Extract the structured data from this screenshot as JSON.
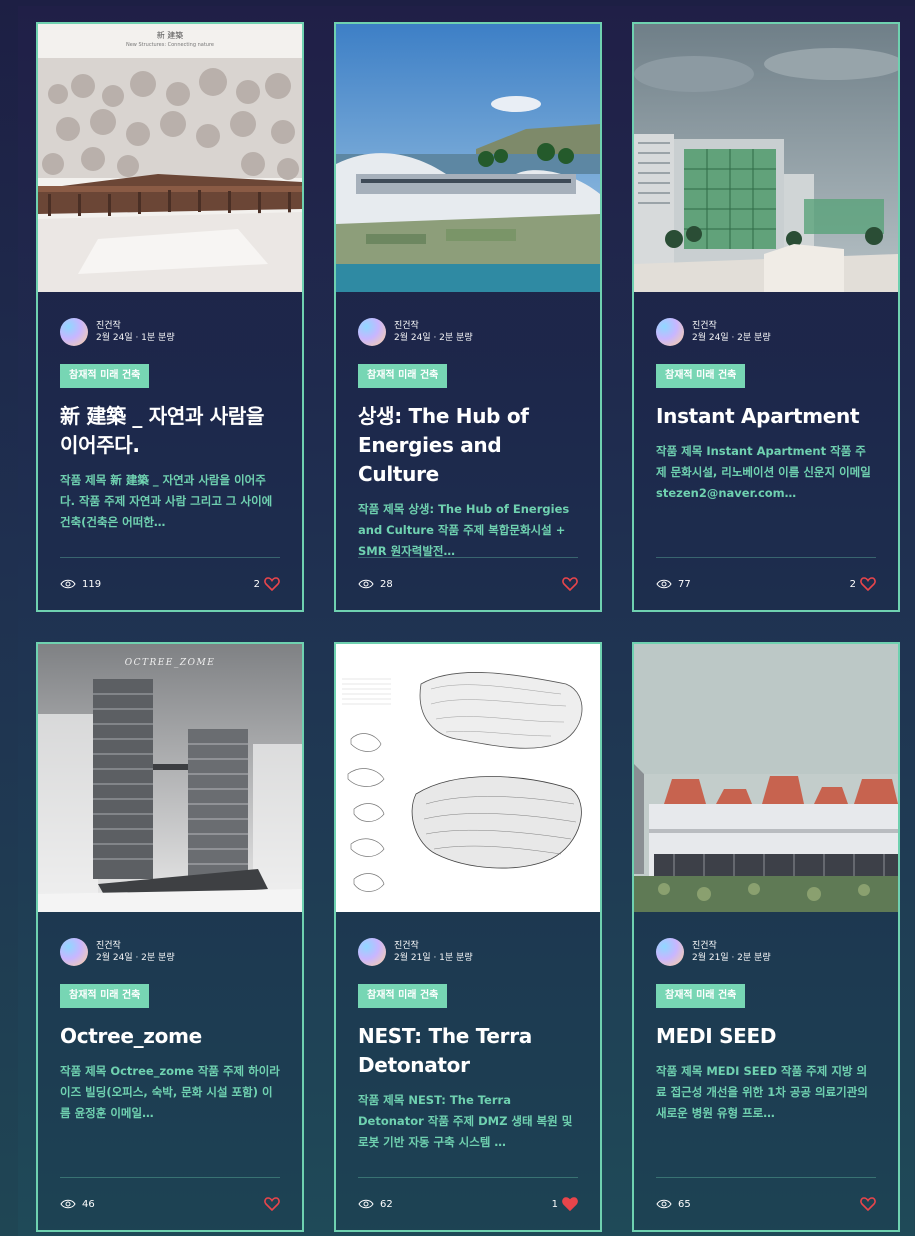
{
  "cards": [
    {
      "author": "진건작",
      "meta": "2월 24일 · 1분 분량",
      "tag": "참재적 미래 건축",
      "title": "新 建築 _ 자연과 사람을 이어주다.",
      "excerpt": "작품 제목 新 建築 _ 자연과 사람을 이어주다. 작품 주제 자연과 사람 그리고 그 사이에 건축(건축은 어떠한…",
      "views": "119",
      "likes": "2",
      "liked": false,
      "image_label": "新 建築",
      "image_sublabel": "New Structures: Connecting nature"
    },
    {
      "author": "진건작",
      "meta": "2월 24일 · 2분 분량",
      "tag": "참재적 미래 건축",
      "title": "상생: The Hub of Energies and Culture",
      "excerpt": "작품 제목 상생: The Hub of Energies and Culture 작품 주제 복합문화시설 + SMR 원자력발전…",
      "views": "28",
      "likes": "",
      "liked": false
    },
    {
      "author": "진건작",
      "meta": "2월 24일 · 2분 분량",
      "tag": "참재적 미래 건축",
      "title": "Instant Apartment",
      "excerpt": "작품 제목 Instant Apartment 작품 주제 문화시설, 리노베이션 이름 신운지 이메일 stezen2@naver.com…",
      "views": "77",
      "likes": "2",
      "liked": false
    },
    {
      "author": "진건작",
      "meta": "2월 24일 · 2분 분량",
      "tag": "참재적 미래 건축",
      "title": "Octree_zome",
      "excerpt": "작품 제목 Octree_zome 작품 주제 하이라이즈 빌딩(오피스, 숙박, 문화 시설 포함) 이름 윤정훈 이메일…",
      "views": "46",
      "likes": "",
      "liked": false,
      "image_label": "OCTREE_ZOME"
    },
    {
      "author": "진건작",
      "meta": "2월 21일 · 1분 분량",
      "tag": "참재적 미래 건축",
      "title": "NEST: The Terra Detonator",
      "excerpt": "작품 제목 NEST: The Terra Detonator 작품 주제 DMZ 생태 복원 및 로봇 기반 자동 구축 시스템 …",
      "views": "62",
      "likes": "1",
      "liked": true
    },
    {
      "author": "진건작",
      "meta": "2월 21일 · 2분 분량",
      "tag": "참재적 미래 건축",
      "title": "MEDI SEED",
      "excerpt": "작품 제목 MEDI SEED 작품 주제 지방 의료 접근성 개선을 위한 1차 공공 의료기관의 새로운 병원 유형 프로…",
      "views": "65",
      "likes": "",
      "liked": false
    }
  ],
  "colors": {
    "accent": "#6fd1b0",
    "tag_bg": "#77d6b4",
    "heart": "#e8454b"
  }
}
